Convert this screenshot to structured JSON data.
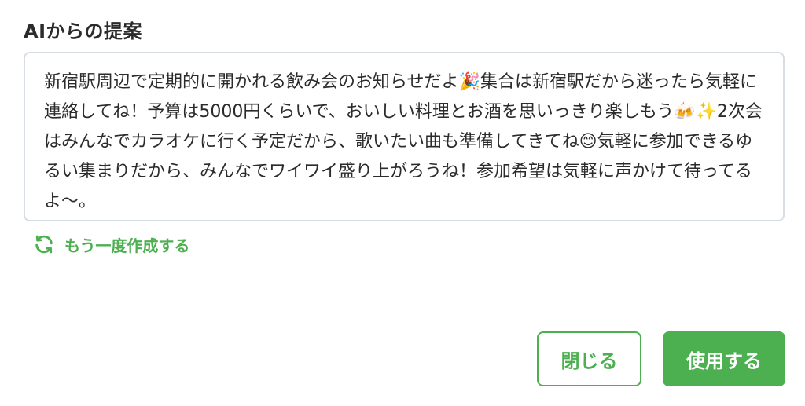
{
  "panel": {
    "title": "AIからの提案"
  },
  "suggestion": {
    "text": "新宿駅周辺で定期的に開かれる飲み会のお知らせだよ🎉集合は新宿駅だから迷ったら気軽に連絡してね！予算は5000円くらいで、おいしい料理とお酒を思いっきり楽しもう🍻✨2次会はみんなでカラオケに行く予定だから、歌いたい曲も準備してきてね😊気軽に参加できるゆるい集まりだから、みんなでワイワイ盛り上がろうね！参加希望は気軽に声かけて待ってるよ〜。"
  },
  "regenerate": {
    "label": "もう一度作成する",
    "icon": "refresh-icon"
  },
  "actions": {
    "close_label": "閉じる",
    "use_label": "使用する"
  },
  "colors": {
    "accent": "#4caf50",
    "border": "#d7dde2",
    "text": "#2b2b2b"
  }
}
